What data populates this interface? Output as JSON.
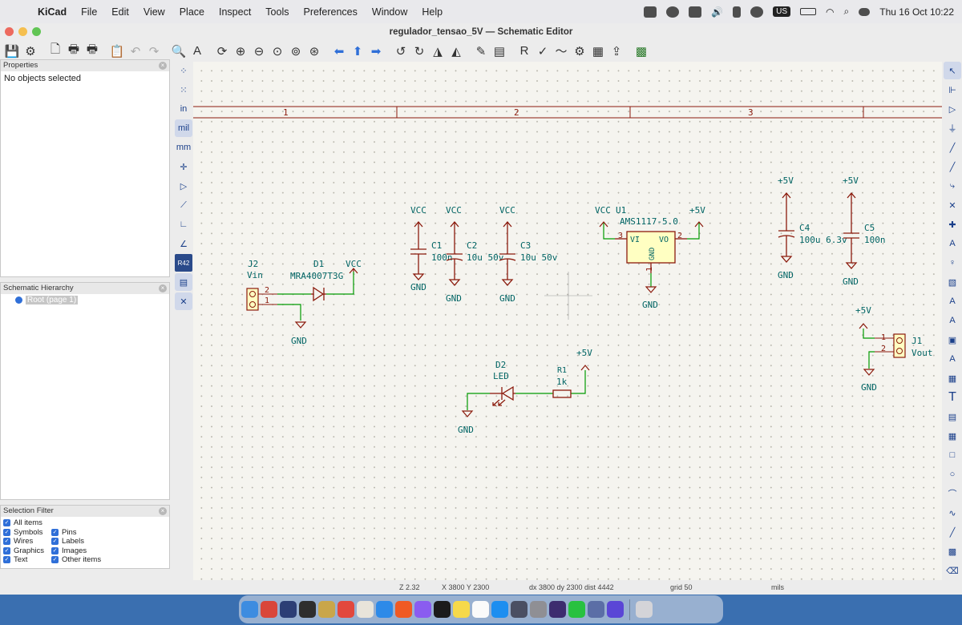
{
  "menubar": {
    "app_name": "KiCad",
    "items": [
      "File",
      "Edit",
      "View",
      "Place",
      "Inspect",
      "Tools",
      "Preferences",
      "Window",
      "Help"
    ],
    "keyboard_layout": "US",
    "datetime": "Thu 16 Oct  10:22"
  },
  "window": {
    "title": "regulador_tensao_5V — Schematic Editor"
  },
  "properties_panel": {
    "title": "Properties",
    "content": "No objects selected"
  },
  "hierarchy_panel": {
    "title": "Schematic Hierarchy",
    "root": "Root (page 1)"
  },
  "selection_filter": {
    "title": "Selection Filter",
    "items": [
      {
        "label": "All items",
        "checked": true
      },
      {
        "label": "Pins",
        "checked": true
      },
      {
        "label": "Symbols",
        "checked": true
      },
      {
        "label": "Labels",
        "checked": true
      },
      {
        "label": "Wires",
        "checked": true
      },
      {
        "label": "Images",
        "checked": true
      },
      {
        "label": "Graphics",
        "checked": true
      },
      {
        "label": "Other items",
        "checked": true
      },
      {
        "label": "Text",
        "checked": true
      }
    ]
  },
  "left_toolbar": {
    "units": [
      "in",
      "mil",
      "mm"
    ],
    "symbol_label": "R42"
  },
  "schematic": {
    "border_zones": [
      "1",
      "2",
      "3"
    ],
    "c_vcc_1": "VCC",
    "c_vcc_2": "VCC",
    "c_vcc_3": "VCC",
    "c1_ref": "C1",
    "c1_val": "100n",
    "c2_ref": "C2",
    "c2_val": "10u 50v",
    "c3_ref": "C3",
    "c3_val": "10u 50v",
    "c_gnd_1": "GND",
    "c_gnd_2": "GND",
    "c_gnd_3": "GND",
    "u1_vcc": "VCC",
    "u1_ref": "U1",
    "u1_val": "AMS1117-5.0",
    "u1_out_pwr": "+5V",
    "u1_pin3": "3",
    "u1_pin2": "2",
    "u1_pin1": "1",
    "u1_vi": "VI",
    "u1_vo": "VO",
    "u1_gnd_pin": "GND",
    "u1_gnd": "GND",
    "c4_pwr": "+5V",
    "c4_ref": "C4",
    "c4_val": "100u 6.3v",
    "c4_gnd": "GND",
    "c5_pwr": "+5V",
    "c5_ref": "C5",
    "c5_val": "100n",
    "c5_gnd": "GND",
    "j2_ref": "J2",
    "j2_val": "Vin",
    "j2_pin2": "2",
    "j2_pin1": "1",
    "j2_gnd": "GND",
    "d1_ref": "D1",
    "d1_val": "MRA4007T3G",
    "d1_vcc": "VCC",
    "d2_ref": "D2",
    "d2_val": "LED",
    "d2_gnd": "GND",
    "r1_ref": "R1",
    "r1_val": "1k",
    "r1_pwr": "+5V",
    "j1_pwr": "+5V",
    "j1_ref": "J1",
    "j1_val": "Vout",
    "j1_pin1": "1",
    "j1_pin2": "2",
    "j1_gnd": "GND"
  },
  "statusbar": {
    "zoom": "Z 2.32",
    "coords": "X 3800  Y 2300",
    "delta": "dx 3800  dy 2300  dist 4442",
    "grid": "grid 50",
    "units": "mils"
  },
  "colors": {
    "wire": "#009a00",
    "component": "#8b1a0c",
    "body_fill": "#ffffc2",
    "text": "#006464",
    "canvas_bg": "#f5f4ef"
  }
}
